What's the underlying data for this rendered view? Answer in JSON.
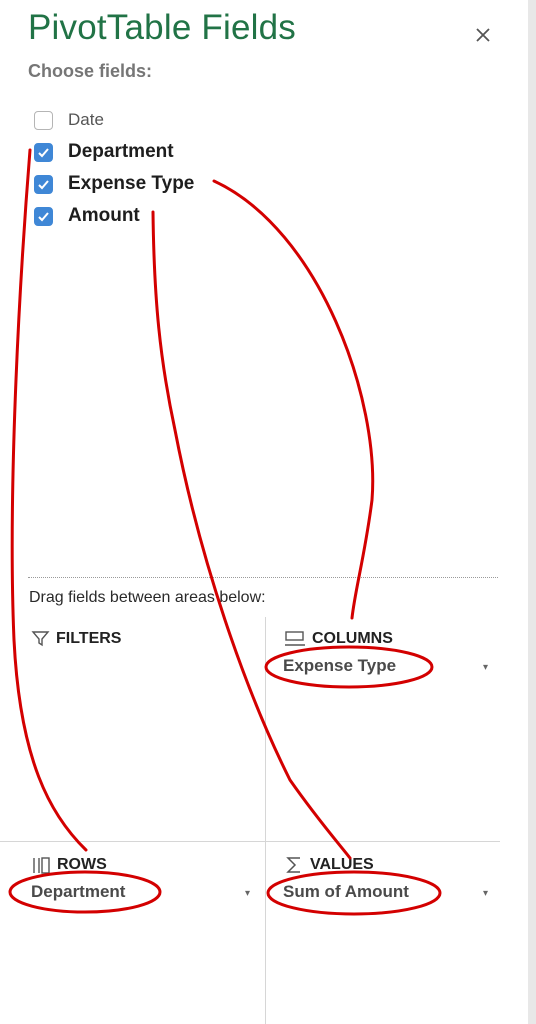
{
  "panel": {
    "title": "PivotTable Fields",
    "subtitle": "Choose fields:",
    "close_icon": "close-icon"
  },
  "fields": [
    {
      "label": "Date",
      "checked": false
    },
    {
      "label": "Department",
      "checked": true
    },
    {
      "label": "Expense Type",
      "checked": true
    },
    {
      "label": "Amount",
      "checked": true
    }
  ],
  "areas": {
    "hint": "Drag fields between areas below:",
    "filters": {
      "label": "FILTERS",
      "icon": "filter-icon"
    },
    "columns": {
      "label": "COLUMNS",
      "icon": "columns-icon",
      "item": "Expense Type"
    },
    "rows": {
      "label": "ROWS",
      "icon": "rows-icon",
      "item": "Department"
    },
    "values": {
      "label": "VALUES",
      "icon": "sigma-icon",
      "item": "Sum of Amount"
    }
  },
  "colors": {
    "title": "#217346",
    "checkbox": "#3f87d6",
    "annotation": "#d30000"
  }
}
